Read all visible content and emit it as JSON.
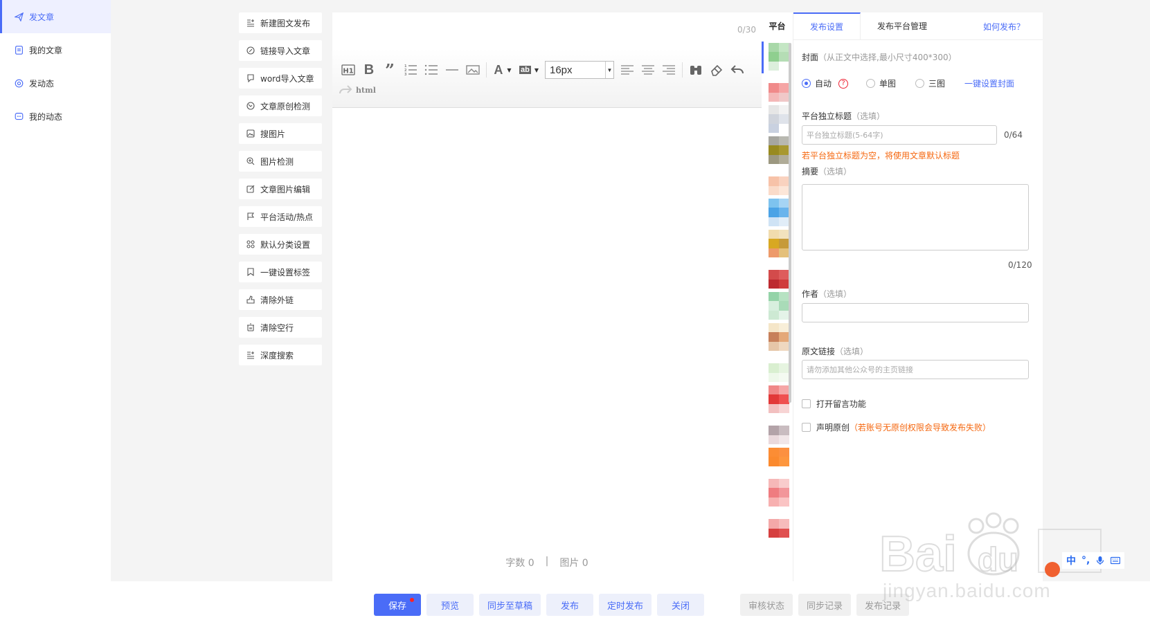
{
  "nav": {
    "items": [
      {
        "label": "发文章",
        "icon": "send-icon",
        "active": true
      },
      {
        "label": "我的文章",
        "icon": "document-icon",
        "active": false
      },
      {
        "label": "发动态",
        "icon": "target-icon",
        "active": false
      },
      {
        "label": "我的动态",
        "icon": "chat-icon",
        "active": false
      }
    ]
  },
  "tools": [
    {
      "label": "新建图文发布",
      "icon": "list-plus-icon"
    },
    {
      "label": "链接导入文章",
      "icon": "link-icon"
    },
    {
      "label": "word导入文章",
      "icon": "import-icon"
    },
    {
      "label": "文章原创检测",
      "icon": "check-circle-icon"
    },
    {
      "label": "搜图片",
      "icon": "image-icon"
    },
    {
      "label": "图片检测",
      "icon": "zoom-icon"
    },
    {
      "label": "文章图片编辑",
      "icon": "edit-icon"
    },
    {
      "label": "平台活动/热点",
      "icon": "flag-icon"
    },
    {
      "label": "默认分类设置",
      "icon": "grid-icon"
    },
    {
      "label": "一键设置标签",
      "icon": "tag-icon"
    },
    {
      "label": "清除外链",
      "icon": "unlink-icon"
    },
    {
      "label": "清除空行",
      "icon": "trash-icon"
    },
    {
      "label": "深度搜索",
      "icon": "search-list-icon"
    }
  ],
  "editor": {
    "title_count": "0/30",
    "font_size": "16px",
    "html_label": "html",
    "word_count": "字数 0",
    "separator": "|",
    "image_count": "图片 0"
  },
  "platform": {
    "header": "平台",
    "tiles": [
      [
        "#a8d8a8",
        "#c4e6c4",
        "#8fcf8f",
        "#b5ddb5",
        "#dcefdc",
        "#ffffff"
      ],
      [
        "#ffffff",
        "#ffffff",
        "#f08a8a",
        "#f5a5a5",
        "#f4b8b8",
        "#f0c8c8"
      ],
      [
        "#e6e6e6",
        "#f2f2f2",
        "#d0d4dc",
        "#dfe3ea",
        "#c9d1e0",
        "#ffffff"
      ],
      [
        "#a6a6a0",
        "#b8b8b0",
        "#988a20",
        "#a89830",
        "#9c9880",
        "#b0ac98"
      ],
      [
        "#ffffff",
        "#ffffff",
        "#f7c2a8",
        "#f9d2bf",
        "#fadbc9",
        "#fce6d8"
      ],
      [
        "#7ec3ef",
        "#a6d4f4",
        "#4ba3e6",
        "#6ab4ec",
        "#cfe3f5",
        "#e1edf8"
      ],
      [
        "#f1dcae",
        "#f2e2be",
        "#d8a822",
        "#c69a3a",
        "#ed9a6a",
        "#e4c07a"
      ],
      [
        "#ffffff",
        "#ffffff",
        "#d34b4b",
        "#de5c5c",
        "#bd2a30",
        "#cf3c3c"
      ],
      [
        "#94d3a8",
        "#b6e2c2",
        "#d7efde",
        "#a9dbb8",
        "#cde9d3",
        "#e4f3e8"
      ],
      [
        "#f5e6c8",
        "#f8eed8",
        "#c7805a",
        "#e4a878",
        "#e6c6a8",
        "#efd8c0"
      ],
      [
        "#ffffff",
        "#ffffff",
        "#d9efd0",
        "#e6f4e0",
        "#eef8ea",
        "#f4faf1"
      ],
      [
        "#f08888",
        "#f5a6a6",
        "#e23838",
        "#ef5050",
        "#f2c0c0",
        "#f7d4d4"
      ],
      [
        "#ffffff",
        "#ffffff",
        "#b3a3a8",
        "#c9bcc0",
        "#ead9dc",
        "#f1e6e8"
      ],
      [
        "#fc8d34",
        "#fc9040",
        "#fb8a2e",
        "#fd963e",
        "#ffffff",
        "#ffffff"
      ],
      [
        "#f6b8b8",
        "#f9cccc",
        "#ef7c80",
        "#f2969a",
        "#f7b0b0",
        "#fac4c4"
      ],
      [
        "#ffffff",
        "#ffffff",
        "#f4a8a8",
        "#f7bcbc",
        "#d64040",
        "#e05050"
      ]
    ]
  },
  "settings": {
    "tabs": [
      "发布设置",
      "发布平台管理"
    ],
    "help_link": "如何发布？",
    "cover_label": "封面",
    "cover_hint": "（从正文中选择,最小尺寸400*300）",
    "cover_options": [
      "自动",
      "单图",
      "三图"
    ],
    "cover_qmark": "?",
    "cover_link": "一键设置封面",
    "title_label": "平台独立标题",
    "title_hint": "（选填）",
    "title_placeholder": "平台独立标题(5-64字)",
    "title_counter": "0/64",
    "title_warning": "若平台独立标题为空，将使用文章默认标题",
    "summary_label": "摘要",
    "summary_hint": "（选填）",
    "summary_counter": "0/120",
    "author_label": "作者",
    "author_hint": "（选填）",
    "source_label": "原文链接",
    "source_hint": "（选填）",
    "source_placeholder": "请勿添加其他公众号的主页链接",
    "comment_label": "打开留言功能",
    "original_label": "声明原创",
    "original_hint": "（若账号无原创权限会导致发布失败）"
  },
  "bottom": {
    "buttons": [
      "保存",
      "预览",
      "同步至草稿",
      "发布",
      "定时发布",
      "关闭"
    ],
    "grey_buttons": [
      "审核状态",
      "同步记录",
      "发布记录"
    ]
  },
  "overlay": {
    "watermark": "jingyan.baidu.com",
    "ime_label": "中",
    "ime_punct": "°,"
  },
  "colors": {
    "accent": "#4a6cf7",
    "warning": "#f5670f"
  }
}
